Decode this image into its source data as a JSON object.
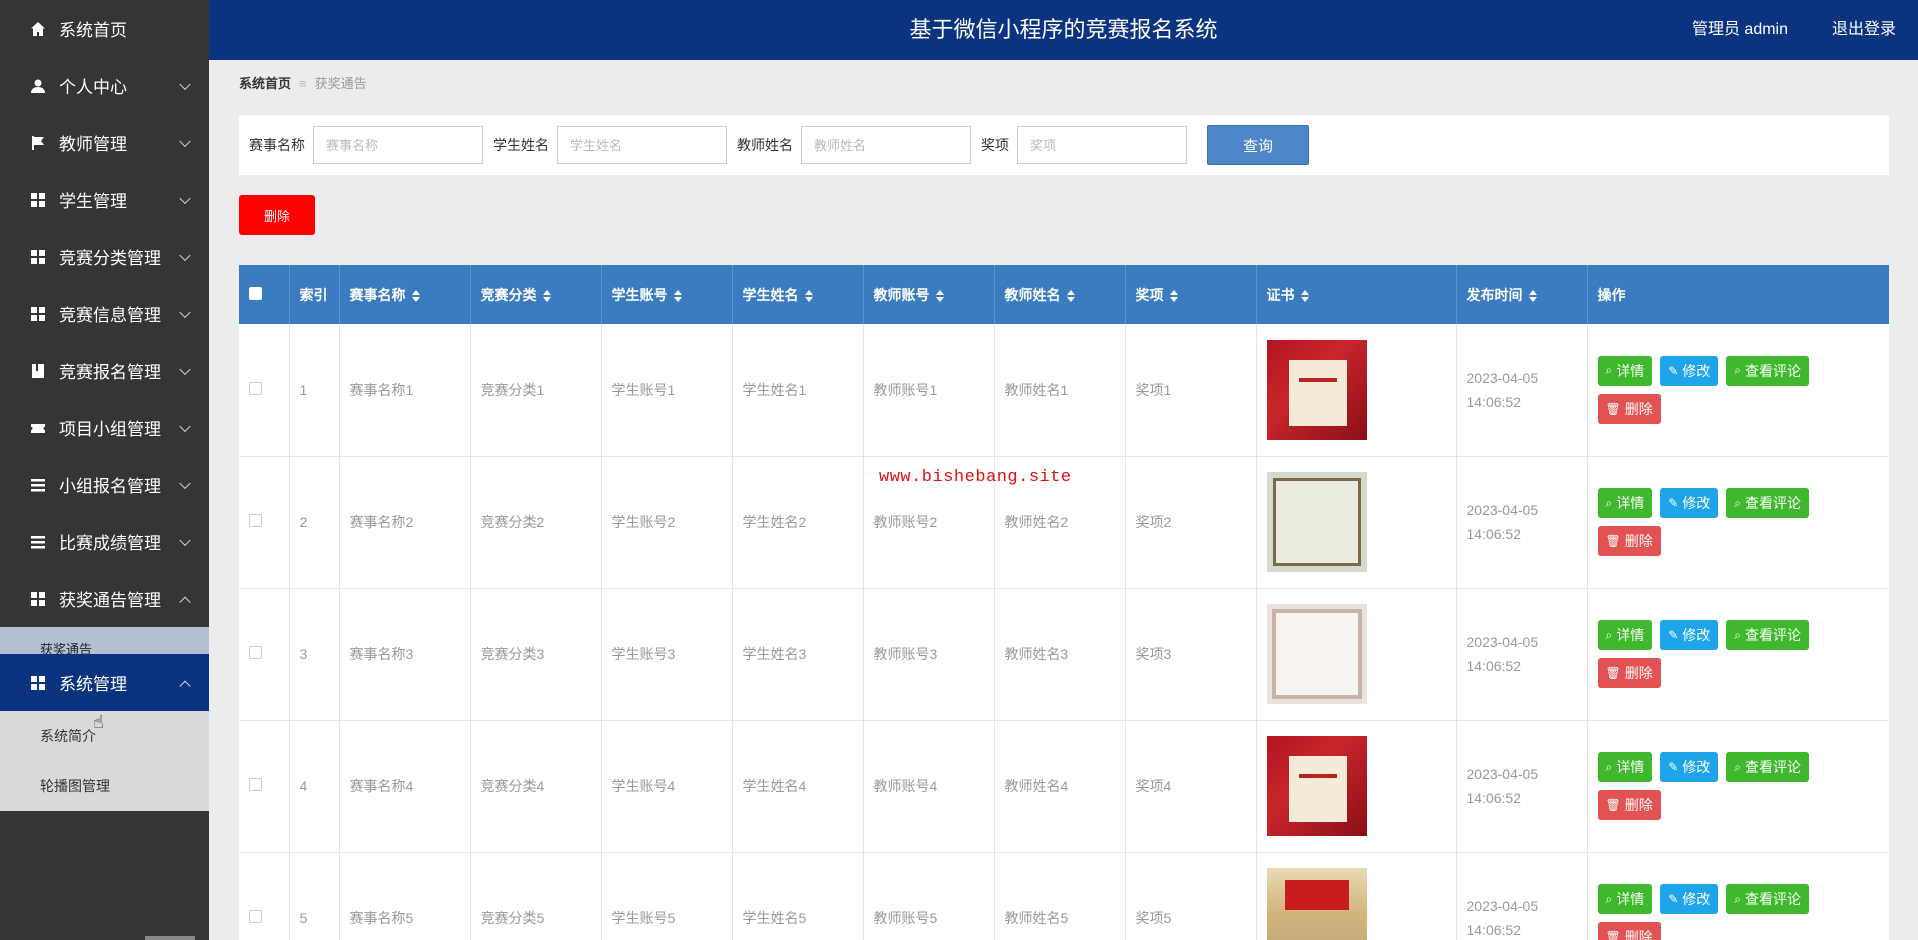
{
  "header": {
    "title": "基于微信小程序的竞赛报名系统",
    "user": "管理员 admin",
    "logout": "退出登录"
  },
  "sidebar": {
    "items": [
      {
        "label": "系统首页",
        "icon": "home-icon"
      },
      {
        "label": "个人中心",
        "icon": "user-icon"
      },
      {
        "label": "教师管理",
        "icon": "flag-icon"
      },
      {
        "label": "学生管理",
        "icon": "grid-icon"
      },
      {
        "label": "竞赛分类管理",
        "icon": "grid-icon"
      },
      {
        "label": "竞赛信息管理",
        "icon": "grid-icon"
      },
      {
        "label": "竞赛报名管理",
        "icon": "book-icon"
      },
      {
        "label": "项目小组管理",
        "icon": "ticket-icon"
      },
      {
        "label": "小组报名管理",
        "icon": "list-icon"
      },
      {
        "label": "比赛成绩管理",
        "icon": "list-icon"
      },
      {
        "label": "获奖通告管理",
        "icon": "grid-icon"
      },
      {
        "label": "系统管理",
        "icon": "grid-icon"
      }
    ],
    "sub_peek": "获奖通告",
    "sub_items": [
      "系统简介",
      "轮播图管理"
    ]
  },
  "breadcrumb": {
    "home": "系统首页",
    "current": "获奖通告"
  },
  "search": {
    "fields": [
      {
        "label": "赛事名称",
        "placeholder": "赛事名称"
      },
      {
        "label": "学生姓名",
        "placeholder": "学生姓名"
      },
      {
        "label": "教师姓名",
        "placeholder": "教师姓名"
      },
      {
        "label": "奖项",
        "placeholder": "奖项"
      }
    ],
    "query_label": "查询"
  },
  "delete_label": "删除",
  "table": {
    "headers": [
      "索引",
      "赛事名称",
      "竞赛分类",
      "学生账号",
      "学生姓名",
      "教师账号",
      "教师姓名",
      "奖项",
      "证书",
      "发布时间",
      "操作"
    ],
    "rows": [
      {
        "idx": "1",
        "name": "赛事名称1",
        "cat": "竞赛分类1",
        "sacc": "学生账号1",
        "sname": "学生姓名1",
        "tacc": "教师账号1",
        "tname": "教师姓名1",
        "award": "奖项1",
        "time": "2023-04-05 14:06:52",
        "cert": "red"
      },
      {
        "idx": "2",
        "name": "赛事名称2",
        "cat": "竞赛分类2",
        "sacc": "学生账号2",
        "sname": "学生姓名2",
        "tacc": "教师账号2",
        "tname": "教师姓名2",
        "award": "奖项2",
        "time": "2023-04-05 14:06:52",
        "cert": "green"
      },
      {
        "idx": "3",
        "name": "赛事名称3",
        "cat": "竞赛分类3",
        "sacc": "学生账号3",
        "sname": "学生姓名3",
        "tacc": "教师账号3",
        "tname": "教师姓名3",
        "award": "奖项3",
        "time": "2023-04-05 14:06:52",
        "cert": "pink"
      },
      {
        "idx": "4",
        "name": "赛事名称4",
        "cat": "竞赛分类4",
        "sacc": "学生账号4",
        "sname": "学生姓名4",
        "tacc": "教师账号4",
        "tname": "教师姓名4",
        "award": "奖项4",
        "time": "2023-04-05 14:06:52",
        "cert": "red"
      },
      {
        "idx": "5",
        "name": "赛事名称5",
        "cat": "竞赛分类5",
        "sacc": "学生账号5",
        "sname": "学生姓名5",
        "tacc": "教师账号5",
        "tname": "教师姓名5",
        "award": "奖项5",
        "time": "2023-04-05 14:06:52",
        "cert": "photo"
      }
    ],
    "actions": {
      "detail": "详情",
      "edit": "修改",
      "comments": "查看评论",
      "delete": "删除"
    }
  },
  "watermark": "www.bishebang.site",
  "colors": {
    "header": "#0b3380",
    "sidebar": "#353535",
    "table_header": "#3b7cc0",
    "green": "#3fb82d",
    "blue": "#1ea5e9",
    "red": "#e25252"
  }
}
